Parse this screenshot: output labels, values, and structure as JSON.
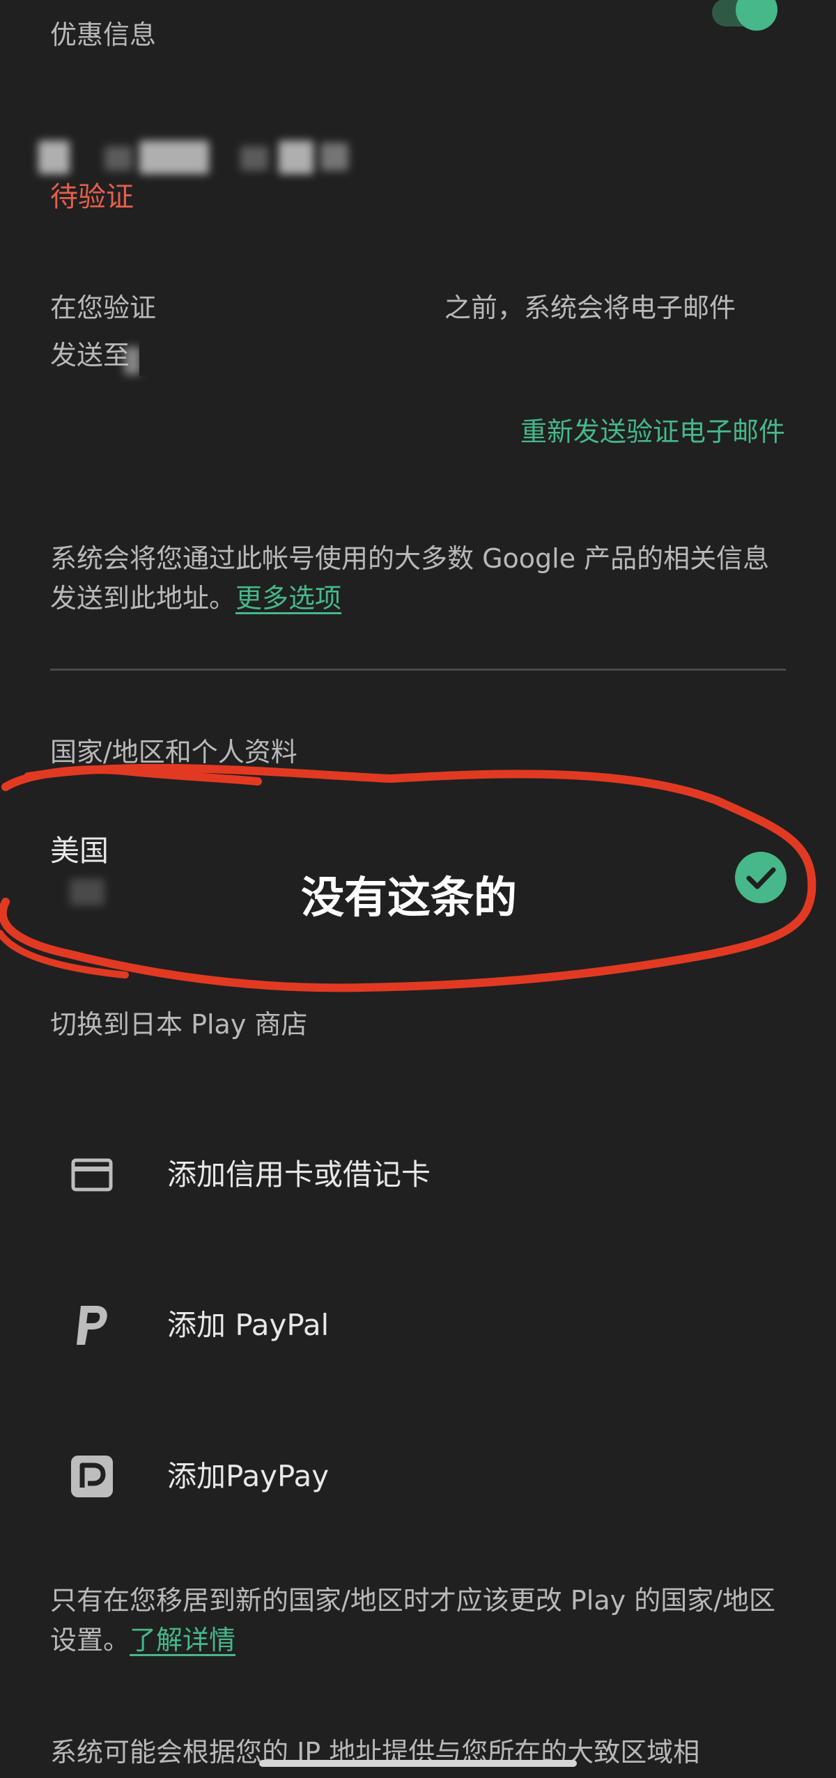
{
  "promo": {
    "label": "优惠信息",
    "toggle_on": true
  },
  "email_status": {
    "status": "待验证"
  },
  "verification": {
    "text_part1": "在您验证",
    "text_part2": "之前，系统会将电子邮件",
    "text_part3": "发送至",
    "resend_link": "重新发送验证电子邮件"
  },
  "address_info": {
    "text": "系统会将您通过此帐号使用的大多数 Google 产品的相关信息发送到此地址。",
    "more_link": "更多选项"
  },
  "country_section": {
    "heading": "国家/地区和个人资料",
    "country": "美国",
    "annotation": "没有这条的",
    "switch_store": "切换到日本 Play 商店"
  },
  "payment_methods": [
    {
      "icon": "credit-card-icon",
      "label": "添加信用卡或借记卡"
    },
    {
      "icon": "paypal-icon",
      "label": "添加 PayPal"
    },
    {
      "icon": "paypay-icon",
      "label": "添加PayPay"
    }
  ],
  "footer": {
    "note": "只有在您移居到新的国家/地区时才应该更改 Play 的国家/地区设置。",
    "learn_more": "了解详情",
    "ip_note": "系统可能会根据您的 IP 地址提供与您所在的大致区域相"
  },
  "colors": {
    "accent": "#46b889",
    "warning": "#e65e4c",
    "annotation": "#e23a22",
    "background": "#202020"
  }
}
